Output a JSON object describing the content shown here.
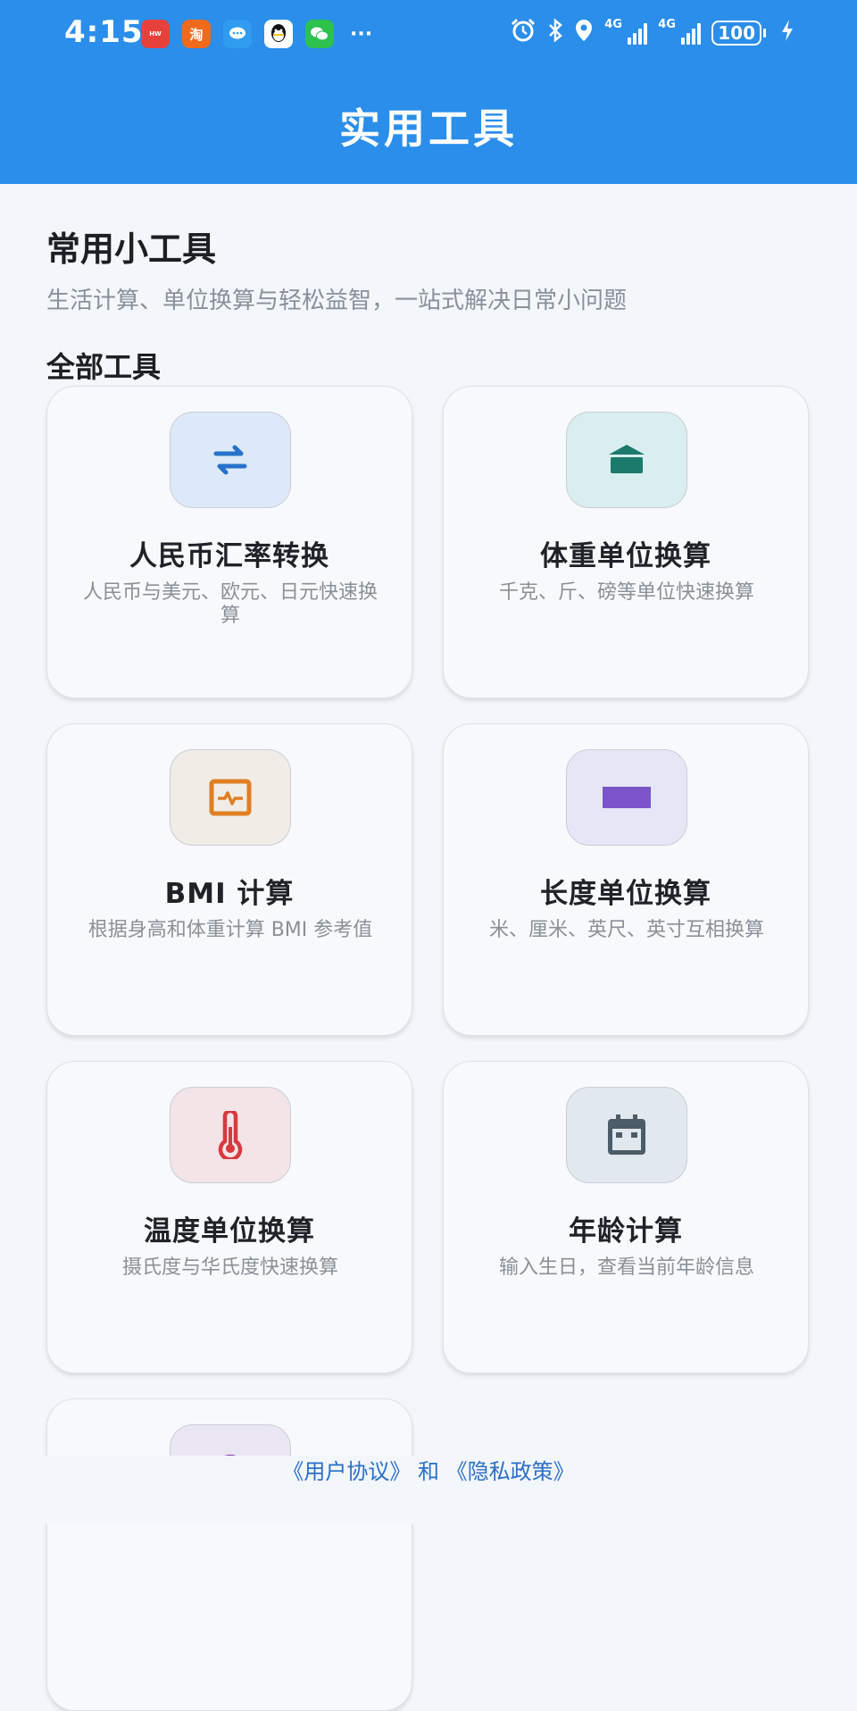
{
  "status_bar": {
    "time": "4:15",
    "network_1": "4G",
    "network_2": "4G",
    "battery": "100",
    "more": "···"
  },
  "header": {
    "title": "实用工具"
  },
  "intro": {
    "title": "常用小工具",
    "subtitle": "生活计算、单位换算与轻松益智，一站式解决日常小问题"
  },
  "tools_section": {
    "title": "全部工具",
    "tools": [
      {
        "name": "人民币汇率转换",
        "desc": "人民币与美元、欧元、日元快速换算",
        "icon": "exchange-arrows-icon",
        "icon_bg": "#dde9f8",
        "icon_color": "#2672c9"
      },
      {
        "name": "体重单位换算",
        "desc": "千克、斤、磅等单位快速换算",
        "icon": "scale-icon",
        "icon_bg": "#d9eeee",
        "icon_color": "#1b7a6c"
      },
      {
        "name": "BMI 计算",
        "desc": "根据身高和体重计算 BMI 参考值",
        "icon": "health-monitor-icon",
        "icon_bg": "#f1ece6",
        "icon_color": "#e07f23"
      },
      {
        "name": "长度单位换算",
        "desc": "米、厘米、英尺、英寸互相换算",
        "icon": "ruler-icon",
        "icon_bg": "#e6e7f6",
        "icon_color": "#7b55c9"
      },
      {
        "name": "温度单位换算",
        "desc": "摄氏度与华氏度快速换算",
        "icon": "thermometer-icon",
        "icon_bg": "#f3e4e8",
        "icon_color": "#d9393f"
      },
      {
        "name": "年龄计算",
        "desc": "输入生日，查看当前年龄信息",
        "icon": "calendar-icon",
        "icon_bg": "#e1e8ee",
        "icon_color": "#4c5c68"
      },
      {
        "name": "",
        "desc": "",
        "icon": "game-icon",
        "icon_bg": "#ebe6f3",
        "icon_color": "#7a3fa8"
      }
    ]
  },
  "footer": {
    "user_agreement": "《用户协议》",
    "and": "和",
    "privacy_policy": "《隐私政策》"
  }
}
